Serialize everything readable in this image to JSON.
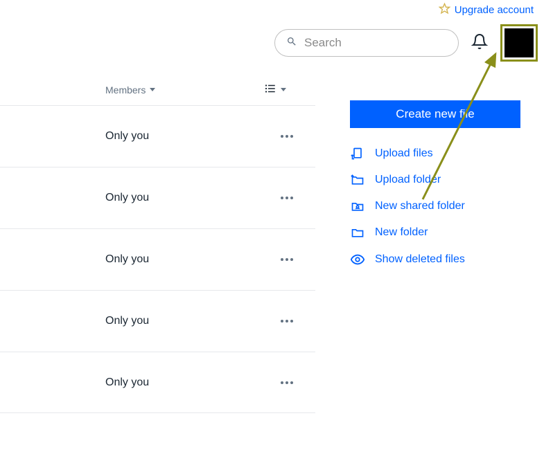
{
  "header": {
    "upgrade_label": "Upgrade account",
    "search_placeholder": "Search"
  },
  "list": {
    "members_header": "Members",
    "rows": [
      {
        "members": "Only you"
      },
      {
        "members": "Only you"
      },
      {
        "members": "Only you"
      },
      {
        "members": "Only you"
      },
      {
        "members": "Only you"
      }
    ]
  },
  "actions": {
    "primary": "Create new file",
    "items": [
      {
        "label": "Upload files"
      },
      {
        "label": "Upload folder"
      },
      {
        "label": "New shared folder"
      },
      {
        "label": "New folder"
      },
      {
        "label": "Show deleted files"
      }
    ]
  }
}
